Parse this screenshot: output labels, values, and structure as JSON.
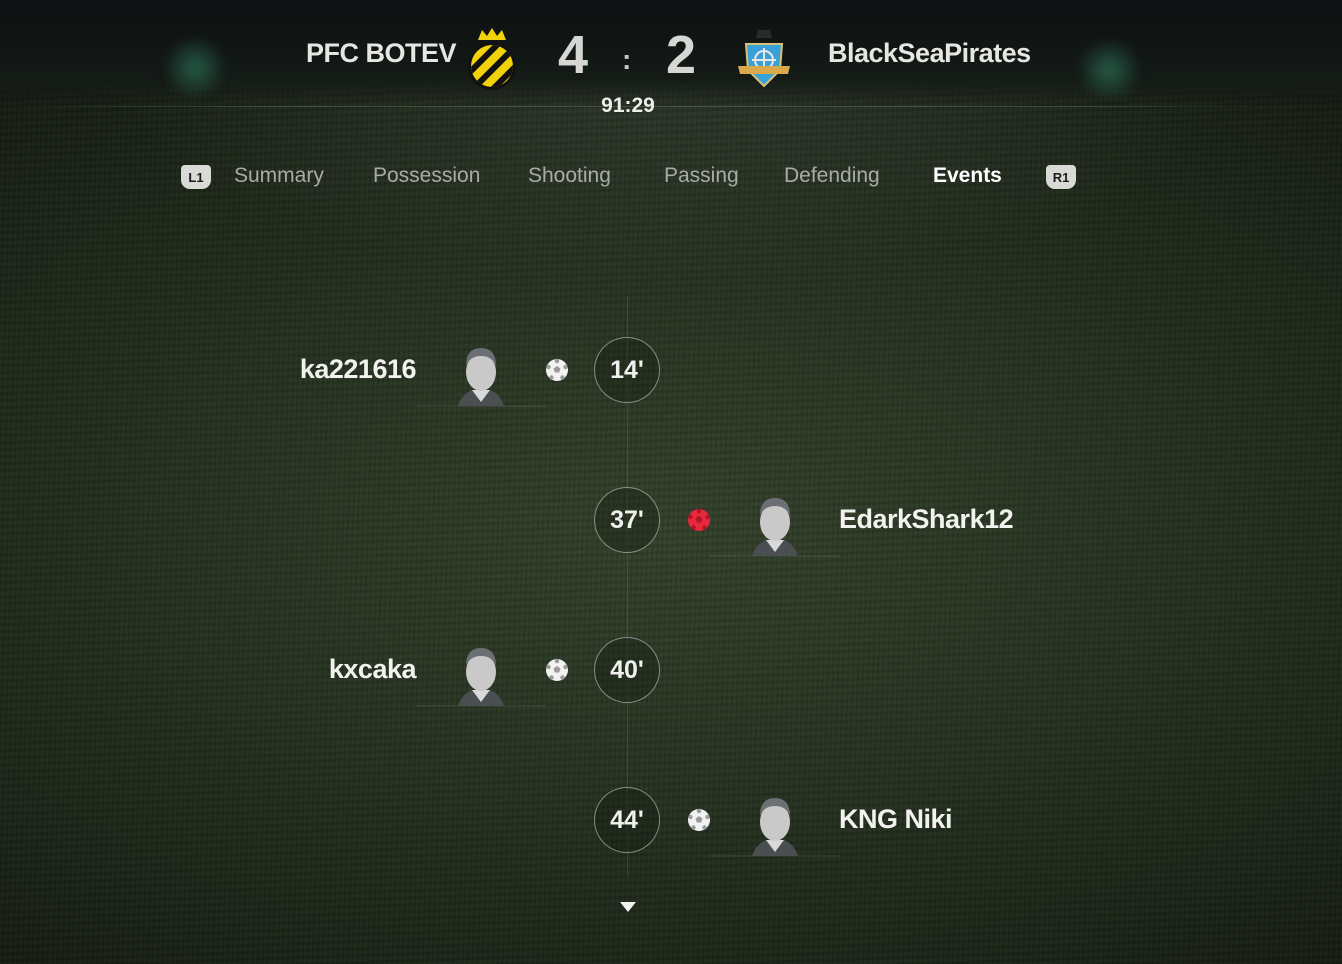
{
  "scoreboard": {
    "home_team": "PFC BOTEV",
    "away_team": "BlackSeaPirates",
    "home_score": "4",
    "separator": ":",
    "away_score": "2",
    "clock": "91:29"
  },
  "tabs": {
    "left_button": "L1",
    "right_button": "R1",
    "items": [
      {
        "label": "Summary",
        "active": false
      },
      {
        "label": "Possession",
        "active": false
      },
      {
        "label": "Shooting",
        "active": false
      },
      {
        "label": "Passing",
        "active": false
      },
      {
        "label": "Defending",
        "active": false
      },
      {
        "label": "Events",
        "active": true
      }
    ]
  },
  "events": [
    {
      "minute": "14'",
      "player": "ka221616",
      "side": "home",
      "type": "goal",
      "icon": "soccer-ball-icon"
    },
    {
      "minute": "37'",
      "player": "EdarkShark12",
      "side": "away",
      "type": "goal",
      "icon": "red-ball-icon"
    },
    {
      "minute": "40'",
      "player": "kxcaka",
      "side": "home",
      "type": "goal",
      "icon": "soccer-ball-icon"
    },
    {
      "minute": "44'",
      "player": "KNG Niki",
      "side": "away",
      "type": "goal",
      "icon": "soccer-ball-icon"
    }
  ],
  "colors": {
    "active_tab": "#ffffff",
    "inactive_tab": "#a9aca4",
    "home_crest_yellow": "#f2d20a",
    "away_crest_blue": "#3aa0d8",
    "red_event": "#e8283c"
  }
}
